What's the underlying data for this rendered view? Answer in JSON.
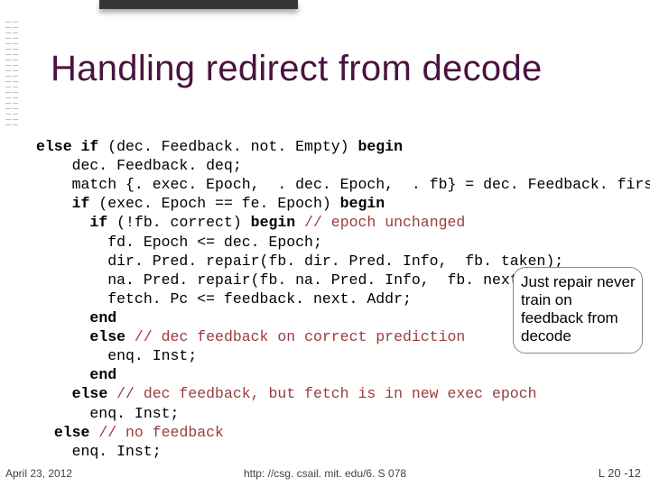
{
  "title": "Handling redirect from decode",
  "code": {
    "l1a": "else if",
    "l1b": " (dec. Feedback. not. Empty) ",
    "l1c": "begin",
    "l2a": "    dec. Feedback. deq;",
    "l3a": "    match {. exec. Epoch,  . dec. Epoch,  . fb} = dec. Feedback. first;",
    "l4a": "    ",
    "l4b": "if",
    "l4c": " (exec. Epoch == fe. Epoch) ",
    "l4d": "begin",
    "l5a": "      ",
    "l5b": "if",
    "l5c": " (!fb. correct) ",
    "l5d": "begin",
    "l5e": " // epoch unchanged",
    "l6a": "        fd. Epoch <= dec. Epoch;",
    "l7a": "        dir. Pred. repair(fb. dir. Pred. Info,  fb. taken);",
    "l8a": "        na. Pred. repair(fb. na. Pred. Info,  fb. next. Addr);",
    "l9a": "        fetch. Pc <= feedback. next. Addr;",
    "l10a": "      ",
    "l10b": "end",
    "l11a": "      ",
    "l11b": "else",
    "l11c": " // dec feedback on correct prediction",
    "l12a": "        enq. Inst;",
    "l13a": "      ",
    "l13b": "end",
    "l14a": "    ",
    "l14b": "else",
    "l14c": " // dec feedback, but fetch is in new exec epoch",
    "l15a": "      enq. Inst;",
    "l16a": "  ",
    "l16b": "else",
    "l16c": " // no feedback",
    "l17a": "    enq. Inst;"
  },
  "callout": "Just repair never train on feedback from decode",
  "footer": {
    "date": "April 23, 2012",
    "url": "http: //csg. csail. mit. edu/6. S 078",
    "page": "L 20 -12"
  }
}
